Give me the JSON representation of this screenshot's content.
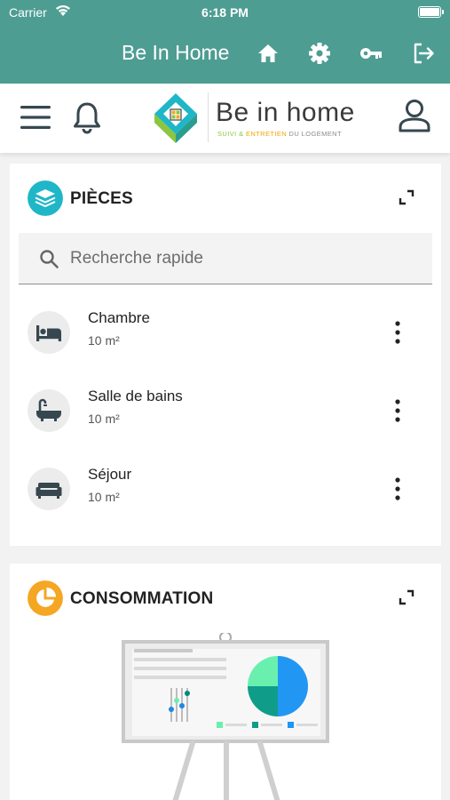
{
  "status_bar": {
    "carrier": "Carrier",
    "time": "6:18 PM"
  },
  "header": {
    "title": "Be In Home",
    "actions": [
      "home-icon",
      "gear-icon",
      "key-icon",
      "logout-icon"
    ]
  },
  "navbar": {
    "logo_text": "Be in home",
    "logo_sub_1": "SUIVI & ",
    "logo_sub_2": "ENTRETIEN",
    "logo_sub_3": " DU LOGEMENT"
  },
  "pieces": {
    "title": "PIÈCES",
    "search_placeholder": "Recherche rapide",
    "rooms": [
      {
        "name": "Chambre",
        "area": "10 m²",
        "icon": "bed-icon"
      },
      {
        "name": "Salle de bains",
        "area": "10 m²",
        "icon": "bathtub-icon"
      },
      {
        "name": "Séjour",
        "area": "10 m²",
        "icon": "sofa-icon"
      }
    ]
  },
  "consommation": {
    "title": "CONSOMMATION"
  },
  "colors": {
    "header_teal": "#4e9d93",
    "pieces_icon": "#1fb6c8",
    "conso_icon": "#f5a623",
    "dark_icon": "#37474f"
  }
}
